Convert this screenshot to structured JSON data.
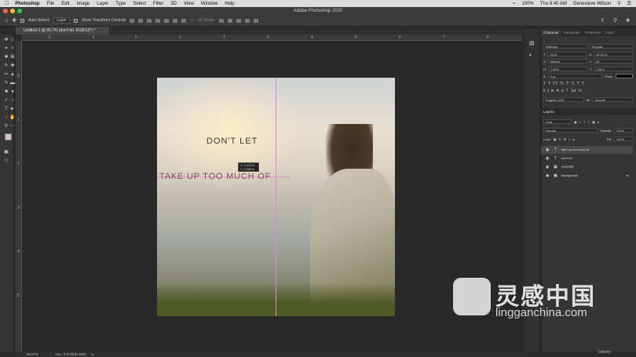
{
  "macbar": {
    "apple": "",
    "app": "Photoshop",
    "menus": [
      "File",
      "Edit",
      "Image",
      "Layer",
      "Type",
      "Select",
      "Filter",
      "3D",
      "View",
      "Window",
      "Help"
    ],
    "status": [
      "100%",
      "Thu 8:40 AM",
      "Genevieve Wilson"
    ]
  },
  "window": {
    "title": "Adobe Photoshop 2020"
  },
  "options": {
    "auto_select": "Auto-Select:",
    "layer_select": "Layer",
    "transform": "Show Transform Controls",
    "mode3d": "3D Mode:"
  },
  "document": {
    "tab": "Untitled-1 @ 66.7% (don't let, RGB/16*) *"
  },
  "canvas": {
    "text_line1": "DON'T LET",
    "text_line2": "TAKE UP TOO MUCH OF",
    "tooltip_x": "X: 3.313 in",
    "tooltip_y": "Y: 0.000 in"
  },
  "status": {
    "zoom": "66.67%",
    "doc": "Doc: 9.67M/31.88M"
  },
  "panel": {
    "tabs": [
      "Character",
      "Paragraph",
      "Properties",
      "Color"
    ],
    "font_family": "Raleway",
    "font_style": "Regular",
    "font_size": "16 pt",
    "leading": "90.53 pt",
    "tracking_label": "Metrics",
    "tracking": "80",
    "vscale": "100%",
    "hscale": "100%",
    "baseline": "0 pt",
    "color_label": "Color:",
    "text_color": "#000000",
    "language": "English: USA",
    "aa": "Smooth"
  },
  "layers": {
    "title": "Layers",
    "kind": "Kind",
    "blend": "Normal",
    "opacity_label": "Opacity:",
    "opacity": "100%",
    "lock_label": "Lock:",
    "fill_label": "Fill:",
    "fill": "100%",
    "items": [
      {
        "name": "take up too much of",
        "type": "T",
        "selected": true
      },
      {
        "name": "don't let",
        "type": "T",
        "selected": false
      },
      {
        "name": "INSPIRE",
        "type": "fx",
        "selected": false
      },
      {
        "name": "Background",
        "type": "img",
        "selected": false
      }
    ]
  },
  "watermark": {
    "cn": "灵感中国",
    "en": "lingganchina.com"
  },
  "udemy": "Udemy",
  "colors": {
    "guide": "#e97fd8",
    "selection_bg": "#4a4a4a"
  }
}
